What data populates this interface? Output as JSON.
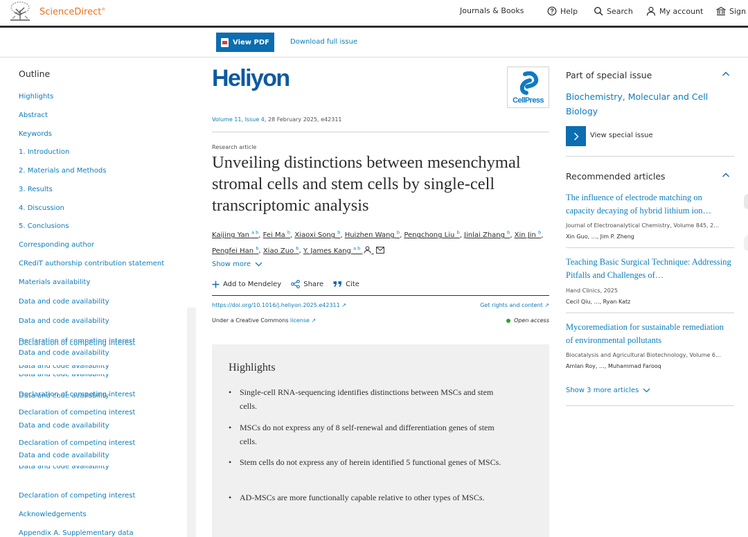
{
  "header": {
    "brand": "ScienceDirect",
    "brand_mark": "®",
    "nav": {
      "journals": "Journals & Books",
      "help": "Help",
      "search": "Search",
      "account": "My account",
      "signin": "Sign in"
    }
  },
  "toolbar": {
    "view_pdf": "View PDF",
    "download_issue": "Download full issue"
  },
  "outline": {
    "title": "Outline",
    "items": [
      "Highlights",
      "Abstract",
      "Keywords",
      "1. Introduction",
      "2. Materials and Methods",
      "3. Results",
      "4. Discussion",
      "5. Conclusions",
      "Corresponding author",
      "CRediT authorship contribution statement",
      "Materials availability",
      "Data and code availability",
      "Data and code availability",
      "Declaration of competing interest",
      "Data and code availability",
      "Data and code availability",
      "Data and code availability",
      "Declaration of competing interest",
      "Declaration of competing interest",
      "Data and code availability",
      "Declaration of competing interest",
      "Data and code availability",
      "Data and code availability",
      "Declaration of competing interest",
      "Acknowledgements",
      "Appendix A. Supplementary data"
    ]
  },
  "article": {
    "journal": "Heliyon",
    "publisher_logo": "CellPress",
    "volume_link": "Volume 11, Issue 4",
    "volume_rest": ", 28 February 2025, e42311",
    "type": "Research article",
    "title": "Unveiling distinctions between mesenchymal stromal cells and stem cells by single-cell transcriptomic analysis",
    "authors": [
      {
        "name": "Kaijing Yan",
        "sup": "a b"
      },
      {
        "name": "Fei Ma",
        "sup": "b"
      },
      {
        "name": "Xiaoxi Song",
        "sup": "b"
      },
      {
        "name": "Huizhen Wang",
        "sup": "b"
      },
      {
        "name": "Pengchong Liu",
        "sup": "b"
      },
      {
        "name": "Jinlai Zhang",
        "sup": "b"
      },
      {
        "name": "Xin Jin",
        "sup": "b"
      },
      {
        "name": "Pengfei Han",
        "sup": "b"
      },
      {
        "name": "Xiao Zuo",
        "sup": "b"
      },
      {
        "name": "Y. James Kang",
        "sup": "a b"
      }
    ],
    "show_more": "Show more",
    "actions": {
      "mendeley": "Add to Mendeley",
      "share": "Share",
      "cite": "Cite"
    },
    "doi": "https://doi.org/10.1016/j.heliyon.2025.e42311",
    "rights": "Get rights and content",
    "license_prefix": "Under a Creative Commons ",
    "license_link": "license",
    "open_access": "Open access",
    "highlights_title": "Highlights",
    "highlights": [
      "Single-cell RNA-sequencing identifies distinctions between MSCs and stem cells.",
      "MSCs do not express any of 8 self-renewal and differentiation genes of stem cells.",
      "Stem cells do not express any of herein identified 5 functional genes of MSCs.",
      "AD-MSCs are more functionally capable relative to other types of MSCs."
    ]
  },
  "rail": {
    "special_issue_heading": "Part of special issue",
    "special_issue_name": "Biochemistry, Molecular and Cell Biology",
    "view_special_issue": "View special issue",
    "recommended_heading": "Recommended articles",
    "recommended": [
      {
        "title": "The influence of electrode matching on capacity decaying of hybrid lithium ion…",
        "source": "Journal of Electroanalytical Chemistry, Volume 845, 2…",
        "authors": "Xin Guo, …, Jim P. Zheng"
      },
      {
        "title": "Teaching Basic Surgical Technique: Addressing Pitfalls and Challenges of…",
        "source": "Hand Clinics, 2025",
        "authors": "Cecil Qiu, …, Ryan Katz"
      },
      {
        "title": "Mycoremediation for sustainable remediation of environmental pollutants",
        "source": "Biocatalysis and Agricultural Biotechnology, Volume 6…",
        "authors": "Amlan Roy, …, Muhammad Farooq"
      }
    ],
    "show_more_articles": "Show 3 more articles"
  },
  "colors": {
    "brand_orange": "#e9711c",
    "link_blue": "#0c7dbb",
    "button_blue": "#0c6db0",
    "journal_blue": "#0c5aa0",
    "open_access_green": "#29a329"
  }
}
